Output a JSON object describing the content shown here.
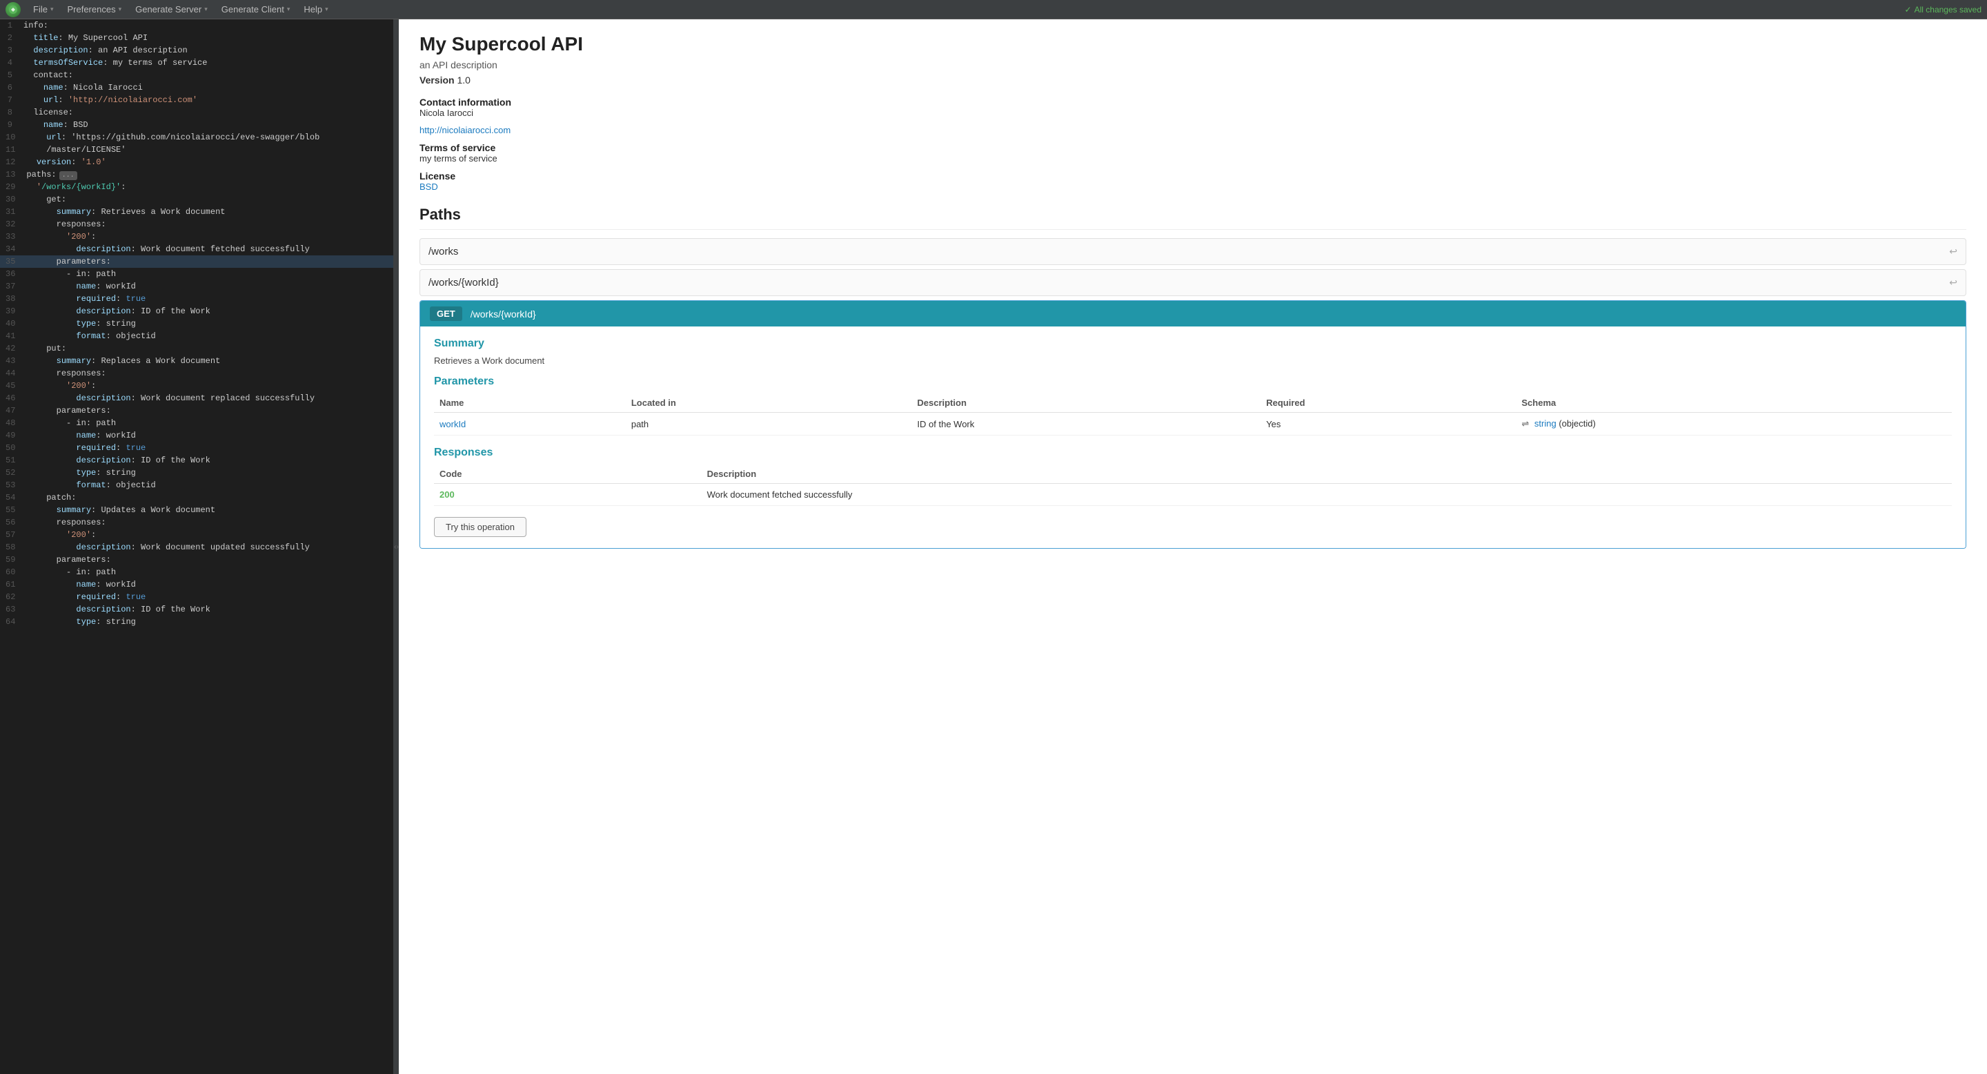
{
  "menubar": {
    "logo": "S",
    "menus": [
      {
        "label": "File",
        "chevron": "▾"
      },
      {
        "label": "Preferences",
        "chevron": "▾"
      },
      {
        "label": "Generate Server",
        "chevron": "▾"
      },
      {
        "label": "Generate Client",
        "chevron": "▾"
      },
      {
        "label": "Help",
        "chevron": "▾"
      }
    ],
    "status": "All changes saved"
  },
  "editor": {
    "lines": [
      {
        "num": 1,
        "content": "info:"
      },
      {
        "num": 2,
        "content": "  title: My Supercool API"
      },
      {
        "num": 3,
        "content": "  description: an API description"
      },
      {
        "num": 4,
        "content": "  termsOfService: my terms of service"
      },
      {
        "num": 5,
        "content": "  contact:"
      },
      {
        "num": 6,
        "content": "    name: Nicola Iarocci"
      },
      {
        "num": 7,
        "content": "    url: 'http://nicolaiarocci.com'"
      },
      {
        "num": 8,
        "content": "  license:"
      },
      {
        "num": 9,
        "content": "    name: BSD"
      },
      {
        "num": 10,
        "content": "    url: 'https://github.com/nicolaiarocci/eve-swagger/blob"
      },
      {
        "num": 11,
        "content": "    /master/LICENSE'"
      },
      {
        "num": 12,
        "content": "  version: '1.0'"
      },
      {
        "num": 13,
        "content": "paths:",
        "badge": true
      },
      {
        "num": 29,
        "content": "  '/works/{workId}':"
      },
      {
        "num": 30,
        "content": "    get:"
      },
      {
        "num": 31,
        "content": "      summary: Retrieves a Work document"
      },
      {
        "num": 32,
        "content": "      responses:"
      },
      {
        "num": 33,
        "content": "        '200':"
      },
      {
        "num": 34,
        "content": "          description: Work document fetched successfully"
      },
      {
        "num": 35,
        "content": "      parameters:",
        "highlight": true
      },
      {
        "num": 36,
        "content": "        - in: path"
      },
      {
        "num": 37,
        "content": "          name: workId"
      },
      {
        "num": 38,
        "content": "          required: true"
      },
      {
        "num": 39,
        "content": "          description: ID of the Work"
      },
      {
        "num": 40,
        "content": "          type: string"
      },
      {
        "num": 41,
        "content": "          format: objectid"
      },
      {
        "num": 42,
        "content": "    put:"
      },
      {
        "num": 43,
        "content": "      summary: Replaces a Work document"
      },
      {
        "num": 44,
        "content": "      responses:"
      },
      {
        "num": 45,
        "content": "        '200':"
      },
      {
        "num": 46,
        "content": "          description: Work document replaced successfully"
      },
      {
        "num": 47,
        "content": "      parameters:"
      },
      {
        "num": 48,
        "content": "        - in: path"
      },
      {
        "num": 49,
        "content": "          name: workId"
      },
      {
        "num": 50,
        "content": "          required: true"
      },
      {
        "num": 51,
        "content": "          description: ID of the Work"
      },
      {
        "num": 52,
        "content": "          type: string"
      },
      {
        "num": 53,
        "content": "          format: objectid"
      },
      {
        "num": 54,
        "content": "    patch:"
      },
      {
        "num": 55,
        "content": "      summary: Updates a Work document"
      },
      {
        "num": 56,
        "content": "      responses:"
      },
      {
        "num": 57,
        "content": "        '200':"
      },
      {
        "num": 58,
        "content": "          description: Work document updated successfully"
      },
      {
        "num": 59,
        "content": "      parameters:"
      },
      {
        "num": 60,
        "content": "        - in: path"
      },
      {
        "num": 61,
        "content": "          name: workId"
      },
      {
        "num": 62,
        "content": "          required: true"
      },
      {
        "num": 63,
        "content": "          description: ID of the Work"
      },
      {
        "num": 64,
        "content": "          type: string"
      }
    ]
  },
  "preview": {
    "api_title": "My Supercool API",
    "api_description": "an API description",
    "version_label": "Version",
    "version_value": "1.0",
    "contact_label": "Contact information",
    "contact_name": "Nicola Iarocci",
    "contact_url": "http://nicolaiarocci.com",
    "tos_label": "Terms of service",
    "tos_value": "my terms of service",
    "license_label": "License",
    "license_value": "BSD",
    "paths_title": "Paths",
    "paths": [
      {
        "path": "/works"
      },
      {
        "path": "/works/{workId}"
      }
    ],
    "endpoint": {
      "method": "GET",
      "path": "/works/{workId}",
      "summary_label": "Summary",
      "summary_value": "Retrieves a Work document",
      "parameters_label": "Parameters",
      "params_headers": [
        "Name",
        "Located in",
        "Description",
        "Required",
        "Schema"
      ],
      "params_rows": [
        {
          "name": "workId",
          "located": "path",
          "description": "ID of the Work",
          "required": "Yes",
          "schema": "string",
          "format": "(objectid)"
        }
      ],
      "responses_label": "Responses",
      "responses_headers": [
        "Code",
        "Description"
      ],
      "responses_rows": [
        {
          "code": "200",
          "description": "Work document fetched successfully"
        }
      ],
      "try_button": "Try this operation",
      "try_text": "this operation Try \""
    }
  }
}
